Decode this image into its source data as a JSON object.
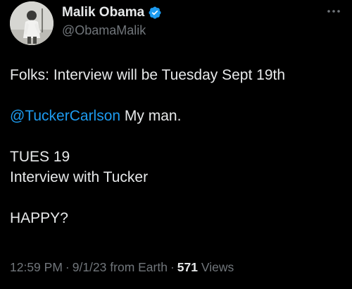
{
  "author": {
    "display_name": "Malik Obama",
    "handle": "@ObamaMalik",
    "verified": true,
    "verified_color": "#1d9bf0"
  },
  "tweet": {
    "line1": "Folks: Interview will be Tuesday Sept 19th",
    "mention": "@TuckerCarlson",
    "line2_rest": " My man.",
    "line3": "TUES 19",
    "line4": "Interview with Tucker",
    "line5": "HAPPY?"
  },
  "meta": {
    "time": "12:59 PM",
    "separator": "·",
    "date": "9/1/23",
    "source": "from Earth",
    "views_count": "571",
    "views_label": " Views"
  },
  "colors": {
    "background": "#000000",
    "text": "#e7e9ea",
    "secondary": "#71767b",
    "link": "#1d9bf0"
  },
  "icons": {
    "verified": "verified-badge-icon",
    "more": "more-options-icon"
  }
}
